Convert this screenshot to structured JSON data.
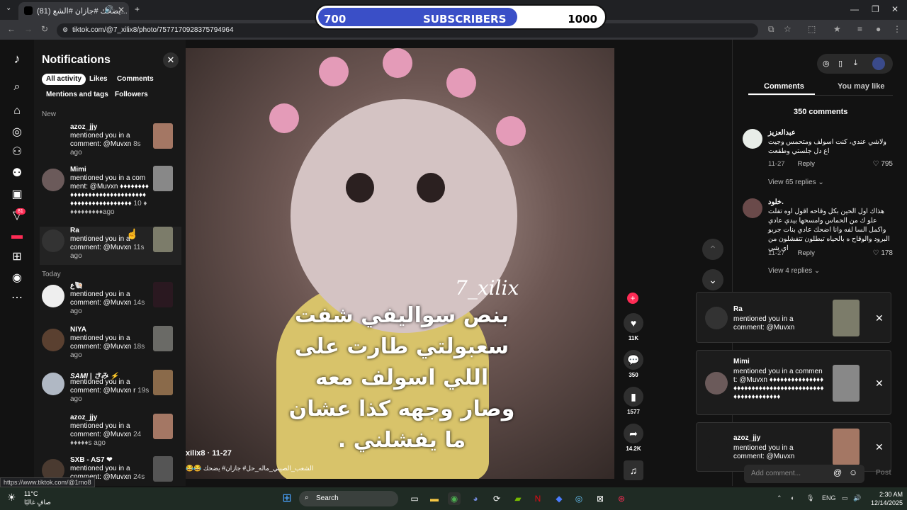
{
  "browser": {
    "tab_title": "(81) يضحك #جازان #الشع...",
    "url": "tiktok.com/@7_xilix8/photo/7577170928375794964",
    "status_url": "https://www.tiktok.com/@1rno8"
  },
  "subscribers": {
    "current": "700",
    "label": "SUBSCRIBERS",
    "goal": "1000",
    "progress": 0.7
  },
  "rail": {
    "inbox_badge": "81"
  },
  "notifications": {
    "title": "Notifications",
    "filters": [
      "All activity",
      "Likes",
      "Comments",
      "Mentions and tags",
      "Followers"
    ],
    "section_new": "New",
    "section_today": "Today",
    "items": [
      {
        "name": "azoz_jjy",
        "text": "mentioned you in a comment: @Muvxn",
        "ago": "8s ago"
      },
      {
        "name": "Mimi",
        "text": "mentioned you in a comment: @Muvxn ♦♦♦♦♦♦♦♦♦♦♦♦♦♦♦♦♦♦♦♦♦♦♦♦♦♦♦♦♦♦♦♦♦♦♦♦♦♦♦♦♦♦♦♦♦♦",
        "ago": "10 ♦♦♦♦♦♦♦♦♦♦ago"
      },
      {
        "name": "Ra",
        "text": "mentioned you in a comment: @Muvxn",
        "ago": "11s ago"
      },
      {
        "name": "ع🐚",
        "text": "mentioned you in a comment: @Muvxn",
        "ago": "14s ago"
      },
      {
        "name": "NIYA",
        "text": "mentioned you in a comment: @Muvxn",
        "ago": "18s ago"
      },
      {
        "name": "SAMI | さみ ⚡",
        "text": "mentioned you in a comment: @Muvxn r",
        "ago": "19s ago"
      },
      {
        "name": "azoz_jjy",
        "text": "mentioned you in a comment: @Muvxn",
        "ago": "24 ♦♦♦♦♦s ago"
      },
      {
        "name": "SXB - AS7 ❤",
        "text": "mentioned you in a comment: @Muvxn",
        "ago": "24s"
      }
    ]
  },
  "video": {
    "overlay_handle": "7_xilix",
    "overlay_caption": "بنص سواليفي شفت سعبولتي طارت على اللي اسولف معه وصار وجهه كذا عشان ما يفشلني .",
    "author": "xilix8 · 11-27",
    "description": "😂😂 الشعب_الصيني_ماله_حل# جازان# يضحك"
  },
  "actions": {
    "likes": "11K",
    "comments": "350",
    "saves": "1577",
    "shares": "14.2K"
  },
  "comments_panel": {
    "tab_comments": "Comments",
    "tab_you_may_like": "You may like",
    "count_label": "350 comments",
    "reply_label": "Reply",
    "comments": [
      {
        "name": "عبدالعزيز",
        "text": "ولاشي عندي، كنت اسولف ومتحمس وجيت اع دل جلستي وطقعت",
        "date": "11-27",
        "likes": "795",
        "more": "View 65 replies"
      },
      {
        "name": "خلود.",
        "text": "هذاك اول الحين بكل وقاحه اقول اوه تفلت علو ك من الحماس وامسحها بيدي عادي واكمل السا لفه وانا اضحك عادي بنات جربو البرود والوقاح ه بالحياه تبطلون تتفشلون من اي شي",
        "date": "11-27",
        "likes": "178",
        "more": "View 4 replies"
      }
    ],
    "add_comment_placeholder": "Add comment...",
    "post_label": "Post"
  },
  "toasts": [
    {
      "name": "Ra",
      "text": "mentioned you in a comment: @Muvxn"
    },
    {
      "name": "Mimi",
      "text": "mentioned you in a comment: @Muvxn ♦♦♦♦♦♦♦♦♦♦♦♦♦♦♦♦♦♦♦♦♦♦♦♦♦♦♦♦♦♦♦♦♦♦♦♦♦♦♦♦♦♦♦♦♦♦♦♦♦♦♦♦♦"
    },
    {
      "name": "azoz_jjy",
      "text": "mentioned you in a comment: @Muvxn"
    }
  ],
  "taskbar": {
    "weather_temp": "11°C",
    "weather_desc": "صافٍ غالبًا",
    "search_label": "Search",
    "lang": "ENG",
    "time": "2:30 AM",
    "date": "12/14/2025"
  }
}
